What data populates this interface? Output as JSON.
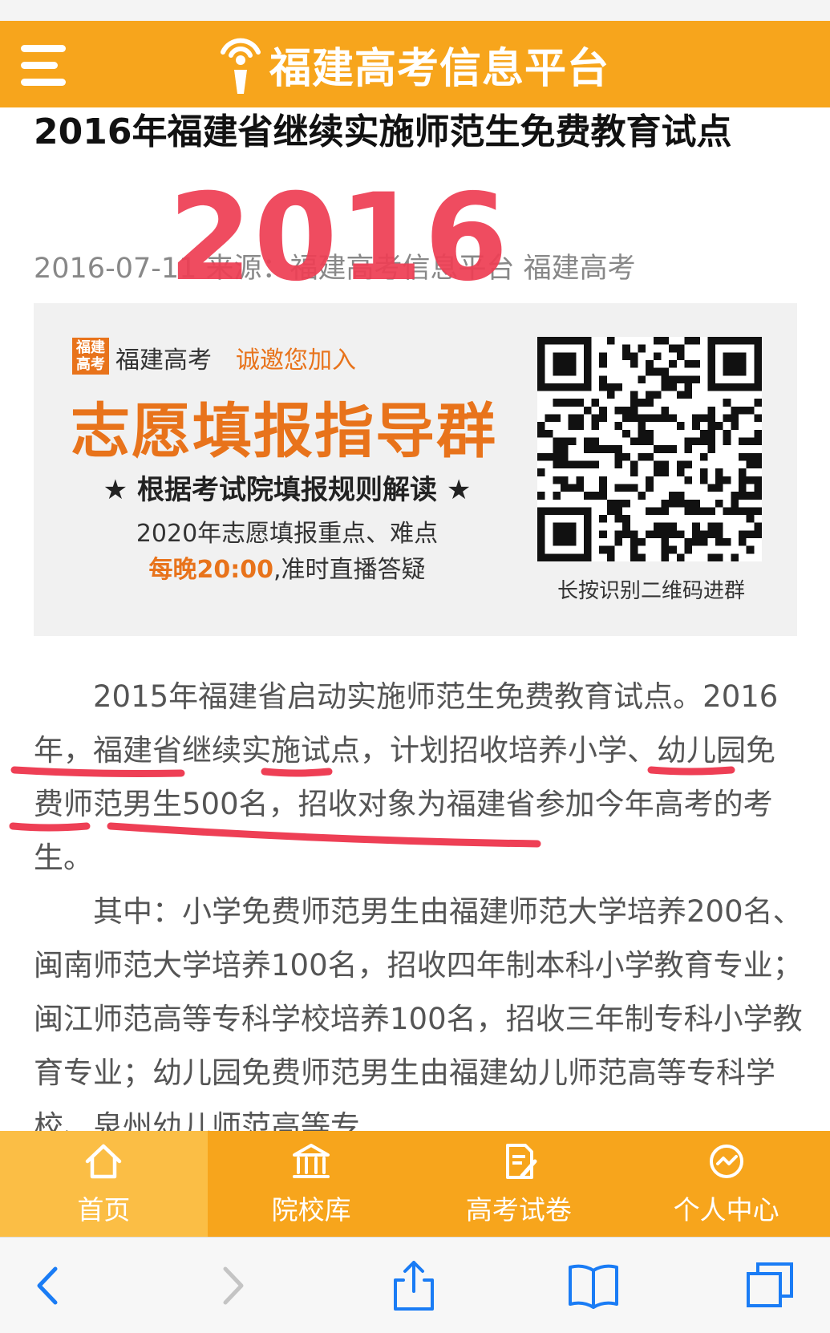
{
  "header": {
    "brand": "福建高考信息平台"
  },
  "article": {
    "title": "2016年福建省继续实施师范生免费教育试点",
    "meta": "2016-07-11 来源：福建高考信息平台 福建高考",
    "annotation_year": "2016",
    "paragraphs": [
      "2015年福建省启动实施师范生免费教育试点。2016年，福建省继续实施试点，计划招收培养小学、幼儿园免费师范男生500名，招收对象为福建省参加今年高考的考生。",
      "其中：小学免费师范男生由福建师范大学培养200名、闽南师范大学培养100名，招收四年制本科小学教育专业；闽江师范高等专科学校培养100名，招收三年制专科小学教育专业；幼儿园免费师范男生由福建幼儿师范高等专科学校、泉州幼儿师范高等专"
    ]
  },
  "banner": {
    "logo_text": "福建高考",
    "brand": "福建高考",
    "invite": "诚邀您加入",
    "main": "志愿填报指导群",
    "sub": "★ 根据考试院填报规则解读 ★",
    "line3": "2020年志愿填报重点、难点",
    "line4_highlight": "每晚20:00",
    "line4_rest": ",准时直播答疑",
    "qr_caption": "长按识别二维码进群"
  },
  "tabs": [
    {
      "label": "首页",
      "icon": "home-icon"
    },
    {
      "label": "院校库",
      "icon": "university-icon"
    },
    {
      "label": "高考试卷",
      "icon": "exam-paper-icon"
    },
    {
      "label": "个人中心",
      "icon": "user-center-icon"
    }
  ],
  "colors": {
    "accent": "#f7a51c",
    "annotation": "#ee3f55",
    "banner_orange": "#e8731b"
  }
}
